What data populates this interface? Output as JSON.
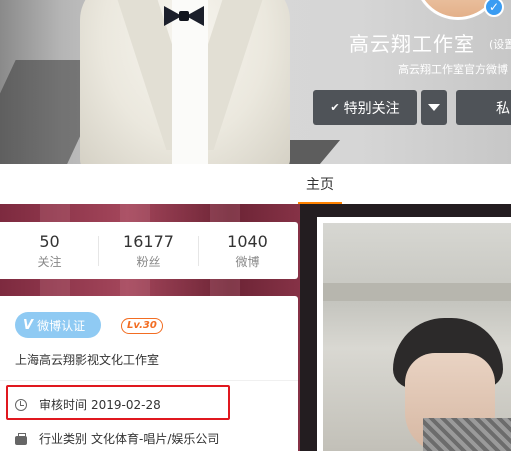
{
  "header": {
    "name": "高云翔工作室",
    "name_suffix": "(设置",
    "intro": "高云翔工作室官方微博",
    "follow_label": "特别关注",
    "follow_icon": "check-icon",
    "more_icon": "chevron-down-icon",
    "message_label": "私"
  },
  "nav": {
    "home_label": "主页"
  },
  "stats": [
    {
      "value": "50",
      "label": "关注"
    },
    {
      "value": "16177",
      "label": "粉丝"
    },
    {
      "value": "1040",
      "label": "微博"
    }
  ],
  "profile": {
    "verify_badge": "微博认证",
    "level": "Lv.30",
    "organization": "上海高云翔影视文化工作室",
    "audit_label": "审核时间",
    "audit_date": "2019-02-28",
    "industry_label": "行业类别",
    "industry_value": "文化体育-唱片/娱乐公司"
  },
  "colors": {
    "accent_orange": "#ff8200",
    "highlight_red": "#e0181f",
    "verified_blue": "#3a9cf2"
  }
}
